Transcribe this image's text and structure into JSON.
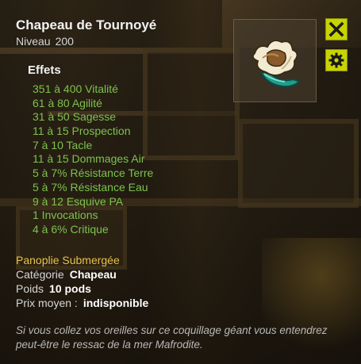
{
  "item": {
    "name": "Chapeau de Tournoyé",
    "level_label": "Niveau",
    "level_value": "200"
  },
  "buttons": {
    "close_icon": "close-icon",
    "settings_icon": "gear-icon"
  },
  "effects": {
    "title": "Effets",
    "items": [
      "351 à 400 Vitalité",
      "61 à 80 Agilité",
      "31 à 50 Sagesse",
      "11 à 15 Prospection",
      "7 à 10 Tacle",
      "11 à 15 Dommages Air",
      "5 à 7% Résistance Terre",
      "5 à 7% Résistance Eau",
      "9 à 12 Esquive PA",
      "1 Invocations",
      "4 à 6% Critique"
    ]
  },
  "set_name": "Panoplie Submergée",
  "info": {
    "category_label": "Catégorie",
    "category_value": "Chapeau",
    "weight_label": "Poids",
    "weight_value": "10 pods",
    "price_label": "Prix moyen :",
    "price_value": "indisponible"
  },
  "description": "Si vous collez vos oreilles sur ce coquillage géant vous entendrez peut-être le ressac de la mer Mafrodite.",
  "colors": {
    "effect_green": "#7cc24e",
    "set_gold": "#e6c34a",
    "button_lime": "#c8d400"
  }
}
